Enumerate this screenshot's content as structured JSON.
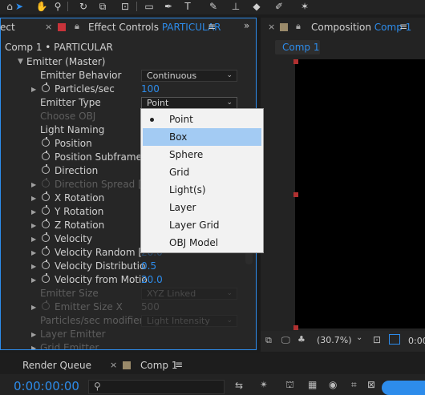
{
  "toolbar": {
    "icons": [
      "home-icon",
      "selection-tool-icon",
      "hand-tool-icon",
      "zoom-tool-icon",
      "rotate-tool-icon",
      "camera-orbit-icon",
      "pan-behind-icon",
      "rectangle-tool-icon",
      "pen-tool-icon",
      "text-tool-icon",
      "brush-tool-icon",
      "clone-stamp-icon",
      "eraser-tool-icon",
      "roto-brush-icon",
      "puppet-pin-icon"
    ]
  },
  "left_panel": {
    "prev_tab": "ect",
    "tab_label": "Effect Controls",
    "tab_target": "PARTICULAR",
    "breadcrumb": "Comp 1 • PARTICULAR"
  },
  "right_panel": {
    "tab_label": "Composition",
    "tab_target": "Comp 1",
    "subtab": "Comp 1",
    "zoom": "(30.7%)",
    "time_partial": "0:00"
  },
  "properties": {
    "emitter_group": "Emitter (Master)",
    "emitter_behavior_label": "Emitter Behavior",
    "emitter_behavior_value": "Continuous",
    "particles_sec_label": "Particles/sec",
    "particles_sec_value": "100",
    "emitter_type_label": "Emitter Type",
    "emitter_type_value": "Point",
    "choose_obj_label": "Choose OBJ",
    "light_naming_label": "Light Naming",
    "position_label": "Position",
    "position_subframe_label": "Position Subframe",
    "direction_label": "Direction",
    "direction_spread_label": "Direction Spread [",
    "x_rotation_label": "X Rotation",
    "y_rotation_label": "Y Rotation",
    "z_rotation_label": "Z Rotation",
    "velocity_label": "Velocity",
    "velocity_random_label": "Velocity Random [",
    "velocity_random_value": "20.0",
    "velocity_distribution_label": "Velocity Distributio",
    "velocity_distribution_value": "0.5",
    "velocity_from_motion_label": "Velocity from Motio",
    "velocity_from_motion_value": "20.0",
    "emitter_size_label": "Emitter Size",
    "emitter_size_value": "XYZ Linked",
    "emitter_size_x_label": "Emitter Size X",
    "emitter_size_x_value": "500",
    "particles_sec_modifier_label": "Particles/sec modifier",
    "particles_sec_modifier_value": "Light Intensity",
    "layer_emitter_label": "Layer Emitter",
    "grid_emitter_label": "Grid Emitter"
  },
  "menu": {
    "items": [
      "Point",
      "Box",
      "Sphere",
      "Grid",
      "Light(s)",
      "Layer",
      "Layer Grid",
      "OBJ Model"
    ],
    "checked": "Point",
    "highlighted": "Box"
  },
  "bottom": {
    "render_queue": "Render Queue",
    "comp_tab": "Comp 1",
    "timecode": "0:00:00:00",
    "search_placeholder": ""
  },
  "colors": {
    "accent": "#2d8ceb",
    "menu_highlight": "#a3cbf3",
    "handle": "#b03030"
  }
}
